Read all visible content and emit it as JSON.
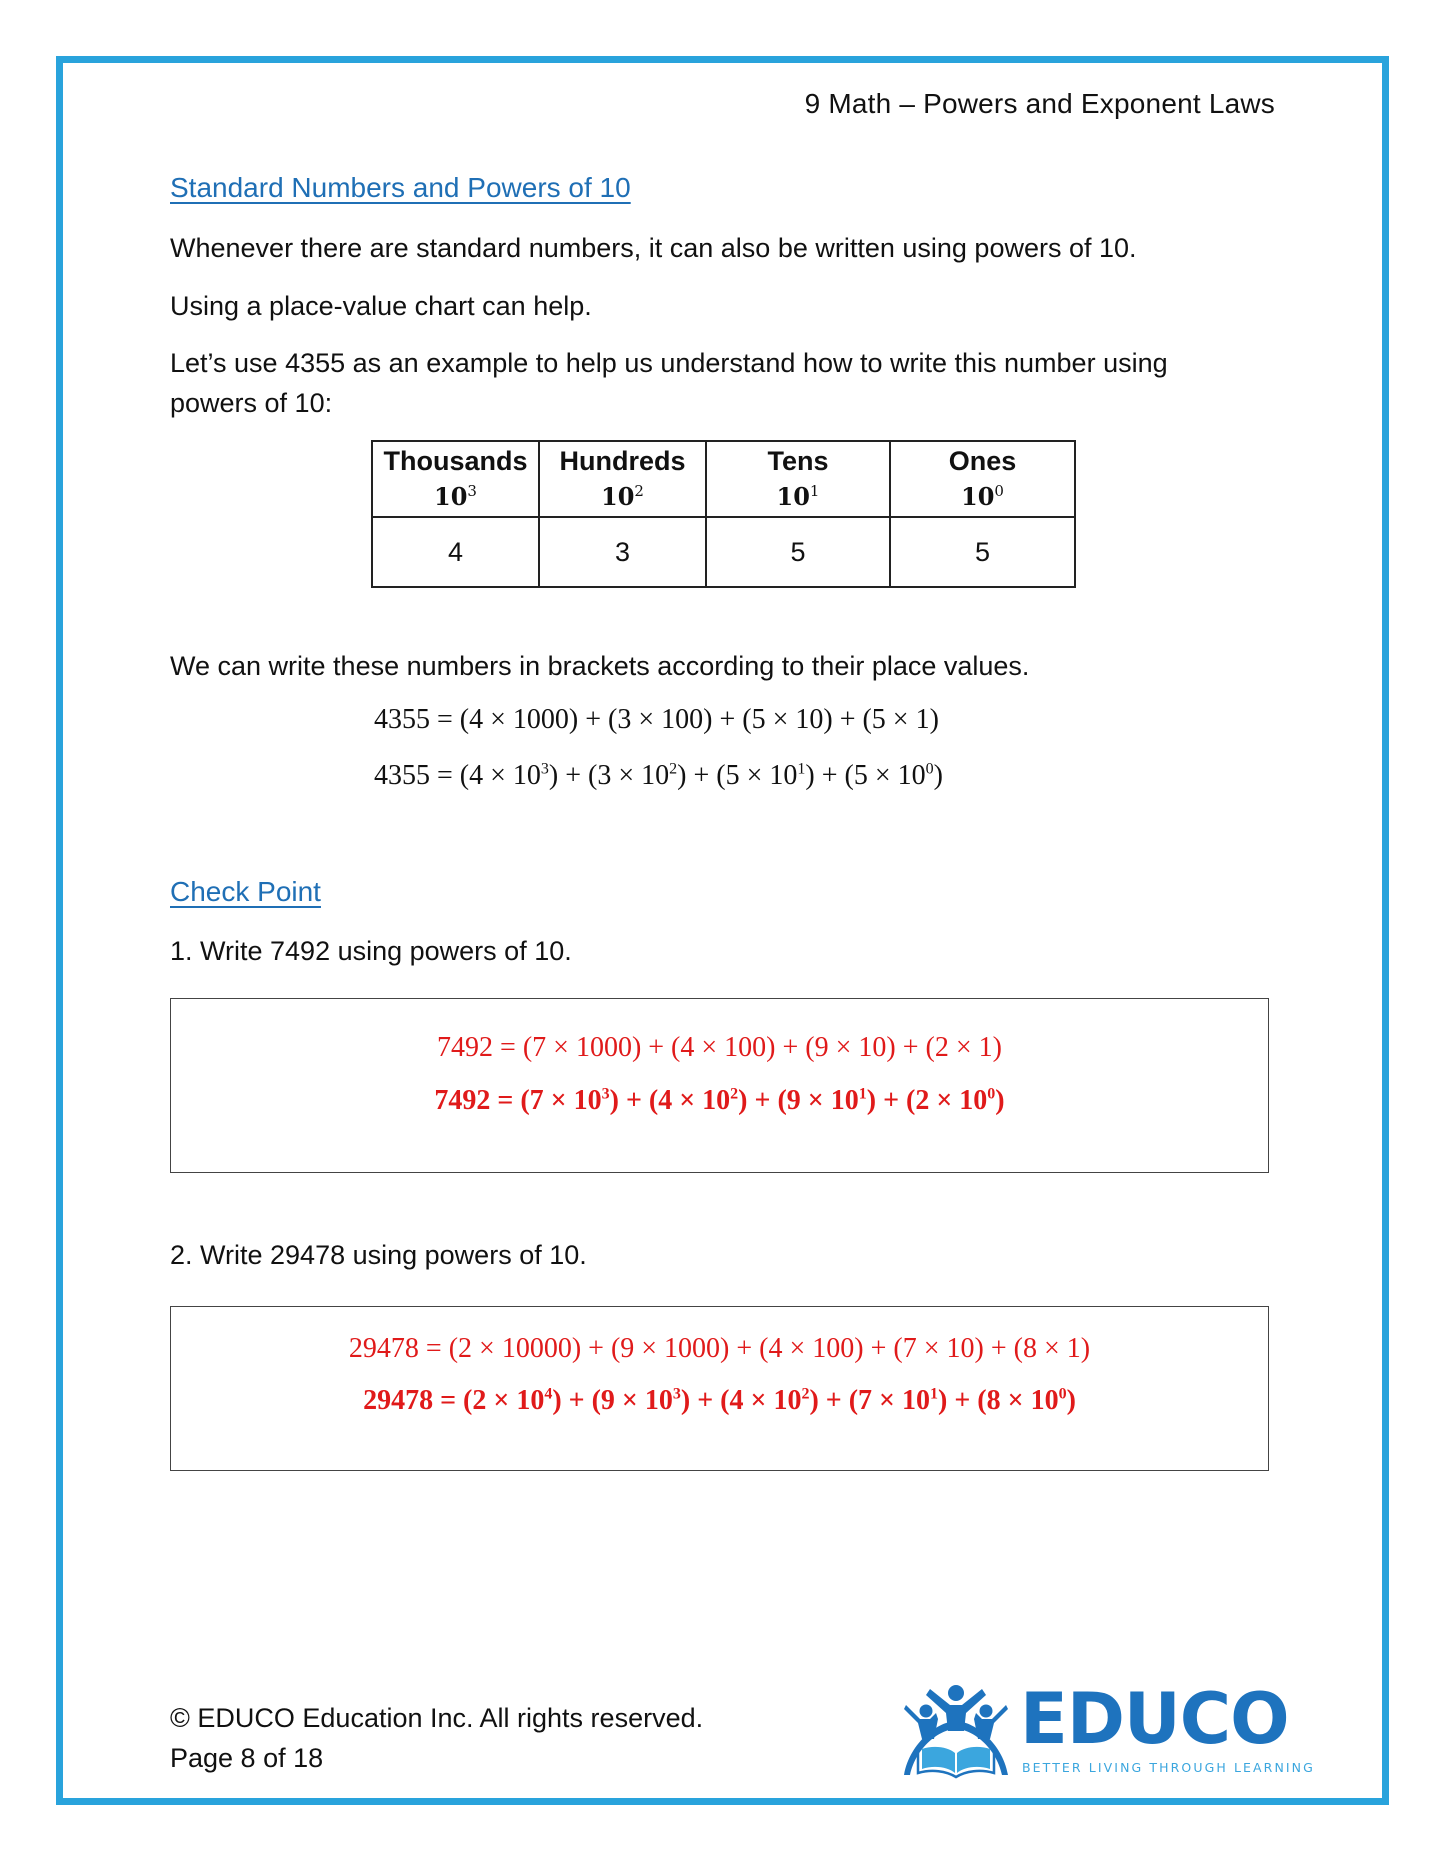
{
  "header": {
    "title": "9 Math – Powers and Exponent Laws"
  },
  "section": {
    "heading": "Standard Numbers and Powers of 10",
    "paragraphs": [
      "Whenever there are standard numbers, it can also be written using powers of 10.",
      "Using a place-value chart can help.",
      "Let’s use 4355 as an example to help us understand how to write this number using",
      "powers of 10:"
    ],
    "place_value_table": {
      "columns": [
        {
          "name": "Thousands",
          "base": "10",
          "exponent": "3",
          "value": "4"
        },
        {
          "name": "Hundreds",
          "base": "10",
          "exponent": "2",
          "value": "3"
        },
        {
          "name": "Tens",
          "base": "10",
          "exponent": "1",
          "value": "5"
        },
        {
          "name": "Ones",
          "base": "10",
          "exponent": "0",
          "value": "5"
        }
      ]
    },
    "bracket_intro": "We can write these numbers in brackets according to their place values.",
    "example_equations": {
      "expanded": "4355 = (4 × 1000) + (3 × 100) + (5 × 10) + (5 × 1)",
      "powers": {
        "lhs": "4355 = ",
        "terms": [
          {
            "coef": "4",
            "exp": "3"
          },
          {
            "coef": "3",
            "exp": "2"
          },
          {
            "coef": "5",
            "exp": "1"
          },
          {
            "coef": "5",
            "exp": "0"
          }
        ]
      }
    }
  },
  "check_point": {
    "heading": "Check Point",
    "questions": [
      {
        "prompt": "1. Write 7492 using powers of 10.",
        "answer_expanded": "7492 = (7 × 1000) + (4 × 100) + (9 × 10) + (2 × 1)",
        "answer_powers": {
          "lhs": "7492",
          "terms": [
            {
              "coef": "7",
              "exp": "3"
            },
            {
              "coef": "4",
              "exp": "2"
            },
            {
              "coef": "9",
              "exp": "1"
            },
            {
              "coef": "2",
              "exp": "0"
            }
          ]
        }
      },
      {
        "prompt": "2. Write 29478 using powers of 10.",
        "answer_expanded": "29478 = (2 × 10000) + (9 × 1000) + (4 × 100) + (7 × 10) + (8 × 1)",
        "answer_powers": {
          "lhs": "29478",
          "terms": [
            {
              "coef": "2",
              "exp": "4"
            },
            {
              "coef": "9",
              "exp": "3"
            },
            {
              "coef": "4",
              "exp": "2"
            },
            {
              "coef": "7",
              "exp": "1"
            },
            {
              "coef": "8",
              "exp": "0"
            }
          ]
        }
      }
    ]
  },
  "footer": {
    "copyright": "© EDUCO Education Inc. All rights reserved.",
    "page": "Page 8 of 18"
  },
  "logo": {
    "wordmark": "EDUCO",
    "tagline": "BETTER LIVING THROUGH LEARNING",
    "icon": "people-over-open-book-icon"
  },
  "colors": {
    "frame": "#29A3DC",
    "heading": "#1F6FB5",
    "answer": "#E01A1A",
    "logo_primary": "#1E73BE",
    "logo_secondary": "#3BA6DE"
  }
}
